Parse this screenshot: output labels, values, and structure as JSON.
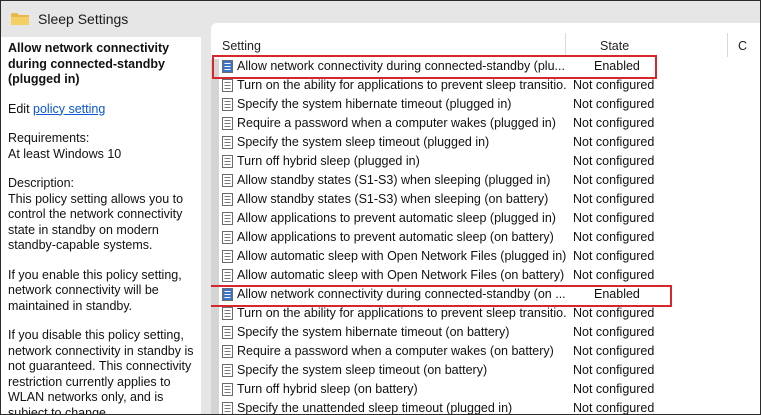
{
  "window": {
    "title": "Sleep Settings",
    "title_icon": "folder-icon"
  },
  "description": {
    "heading": "Allow network connectivity during connected-standby (plugged in)",
    "edit_prefix": "Edit ",
    "edit_link": "policy setting",
    "requirements_label": "Requirements:",
    "requirements_value": "At least Windows 10",
    "description_label": "Description:",
    "description_text": "This policy setting allows you to control the network connectivity state in standby on modern standby-capable systems.",
    "enable_text": "If you enable this policy setting, network connectivity will be maintained in standby.",
    "disable_text": "If you disable this policy setting, network connectivity in standby is not guaranteed. This connectivity restriction currently applies to WLAN networks only, and is subject to change."
  },
  "columns": {
    "setting": "Setting",
    "state": "State",
    "comment": "C"
  },
  "rows": [
    {
      "name": "Allow network connectivity during connected-standby (plu...",
      "state": "Enabled"
    },
    {
      "name": "Turn on the ability for applications to prevent sleep transitio...",
      "state": "Not configured"
    },
    {
      "name": "Specify the system hibernate timeout (plugged in)",
      "state": "Not configured"
    },
    {
      "name": "Require a password when a computer wakes (plugged in)",
      "state": "Not configured"
    },
    {
      "name": "Specify the system sleep timeout (plugged in)",
      "state": "Not configured"
    },
    {
      "name": "Turn off hybrid sleep (plugged in)",
      "state": "Not configured"
    },
    {
      "name": "Allow standby states (S1-S3) when sleeping (plugged in)",
      "state": "Not configured"
    },
    {
      "name": "Allow standby states (S1-S3) when sleeping (on battery)",
      "state": "Not configured"
    },
    {
      "name": "Allow applications to prevent automatic sleep (plugged in)",
      "state": "Not configured"
    },
    {
      "name": "Allow applications to prevent automatic sleep (on battery)",
      "state": "Not configured"
    },
    {
      "name": "Allow automatic sleep with Open Network Files (plugged in)",
      "state": "Not configured"
    },
    {
      "name": "Allow automatic sleep with Open Network Files (on battery)",
      "state": "Not configured"
    },
    {
      "name": "Allow network connectivity during connected-standby (on ...",
      "state": "Enabled"
    },
    {
      "name": "Turn on the ability for applications to prevent sleep transitio...",
      "state": "Not configured"
    },
    {
      "name": "Specify the system hibernate timeout (on battery)",
      "state": "Not configured"
    },
    {
      "name": "Require a password when a computer wakes (on battery)",
      "state": "Not configured"
    },
    {
      "name": "Specify the system sleep timeout (on battery)",
      "state": "Not configured"
    },
    {
      "name": "Turn off hybrid sleep (on battery)",
      "state": "Not configured"
    },
    {
      "name": "Specify the unattended sleep timeout (plugged in)",
      "state": "Not configured"
    }
  ],
  "colors": {
    "highlight_border": "#d9262c",
    "link": "#0b57d0",
    "chrome": "#e6e6e6"
  }
}
